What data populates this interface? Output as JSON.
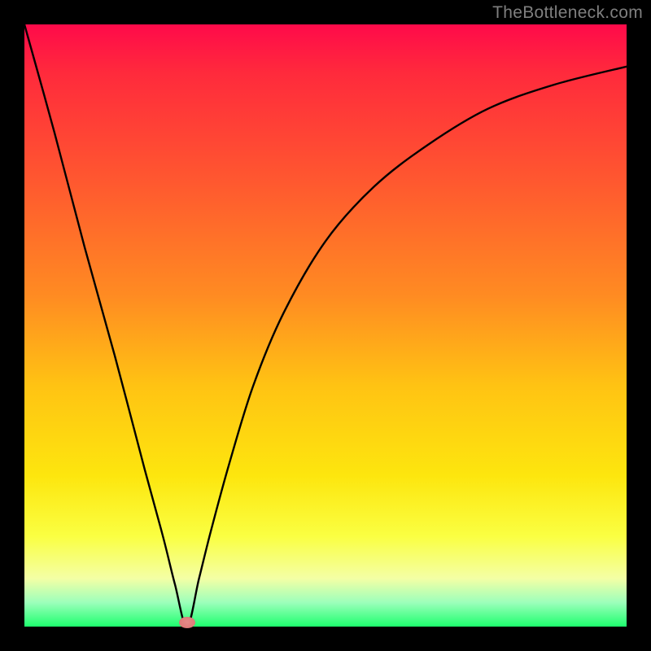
{
  "watermark": "TheBottleneck.com",
  "colors": {
    "background": "#000000",
    "gradient_top": "#ff0a4a",
    "gradient_bottom": "#1eff6e",
    "curve": "#000000",
    "min_point": "#e07e7c"
  },
  "chart_data": {
    "type": "line",
    "title": "",
    "xlabel": "",
    "ylabel": "",
    "xlim": [
      0,
      100
    ],
    "ylim": [
      0,
      100
    ],
    "min_point": {
      "x": 27,
      "y": 0
    },
    "series": [
      {
        "name": "bottleneck-curve",
        "x": [
          0,
          5,
          10,
          15,
          20,
          23,
          25,
          27,
          29,
          31,
          34,
          38,
          43,
          50,
          58,
          67,
          77,
          88,
          100
        ],
        "y": [
          100,
          82,
          63,
          45,
          26,
          15,
          7,
          0,
          8,
          16,
          27,
          40,
          52,
          64,
          73,
          80,
          86,
          90,
          93
        ]
      }
    ]
  }
}
